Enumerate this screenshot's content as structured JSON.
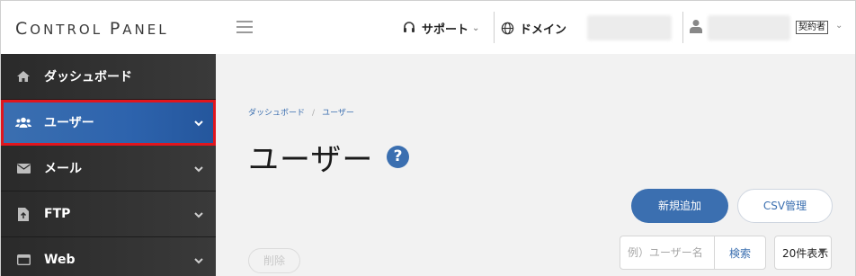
{
  "header": {
    "logo_first": "C",
    "logo_rest1": "ONTROL ",
    "logo_p": "P",
    "logo_rest2": "ANEL",
    "support_label": "サポート",
    "domain_label": "ドメイン",
    "role_badge": "契約者"
  },
  "sidebar": {
    "items": [
      {
        "label": "ダッシュボード",
        "icon": "home-icon"
      },
      {
        "label": "ユーザー",
        "icon": "users-icon",
        "active": true
      },
      {
        "label": "メール",
        "icon": "mail-icon"
      },
      {
        "label": "FTP",
        "icon": "file-upload-icon"
      },
      {
        "label": "Web",
        "icon": "window-icon"
      }
    ]
  },
  "main": {
    "breadcrumb": [
      "ダッシュボード",
      "ユーザー"
    ],
    "title": "ユーザー",
    "help": "?",
    "add_button": "新規追加",
    "csv_button": "CSV管理",
    "delete_button": "削除",
    "search_placeholder": "例）ユーザー名",
    "search_button": "検索",
    "per_page": "20件表示"
  },
  "colors": {
    "accent": "#3b6fb0",
    "highlight_border": "#e0161e",
    "sidebar_bg": "#2b2b2b"
  }
}
